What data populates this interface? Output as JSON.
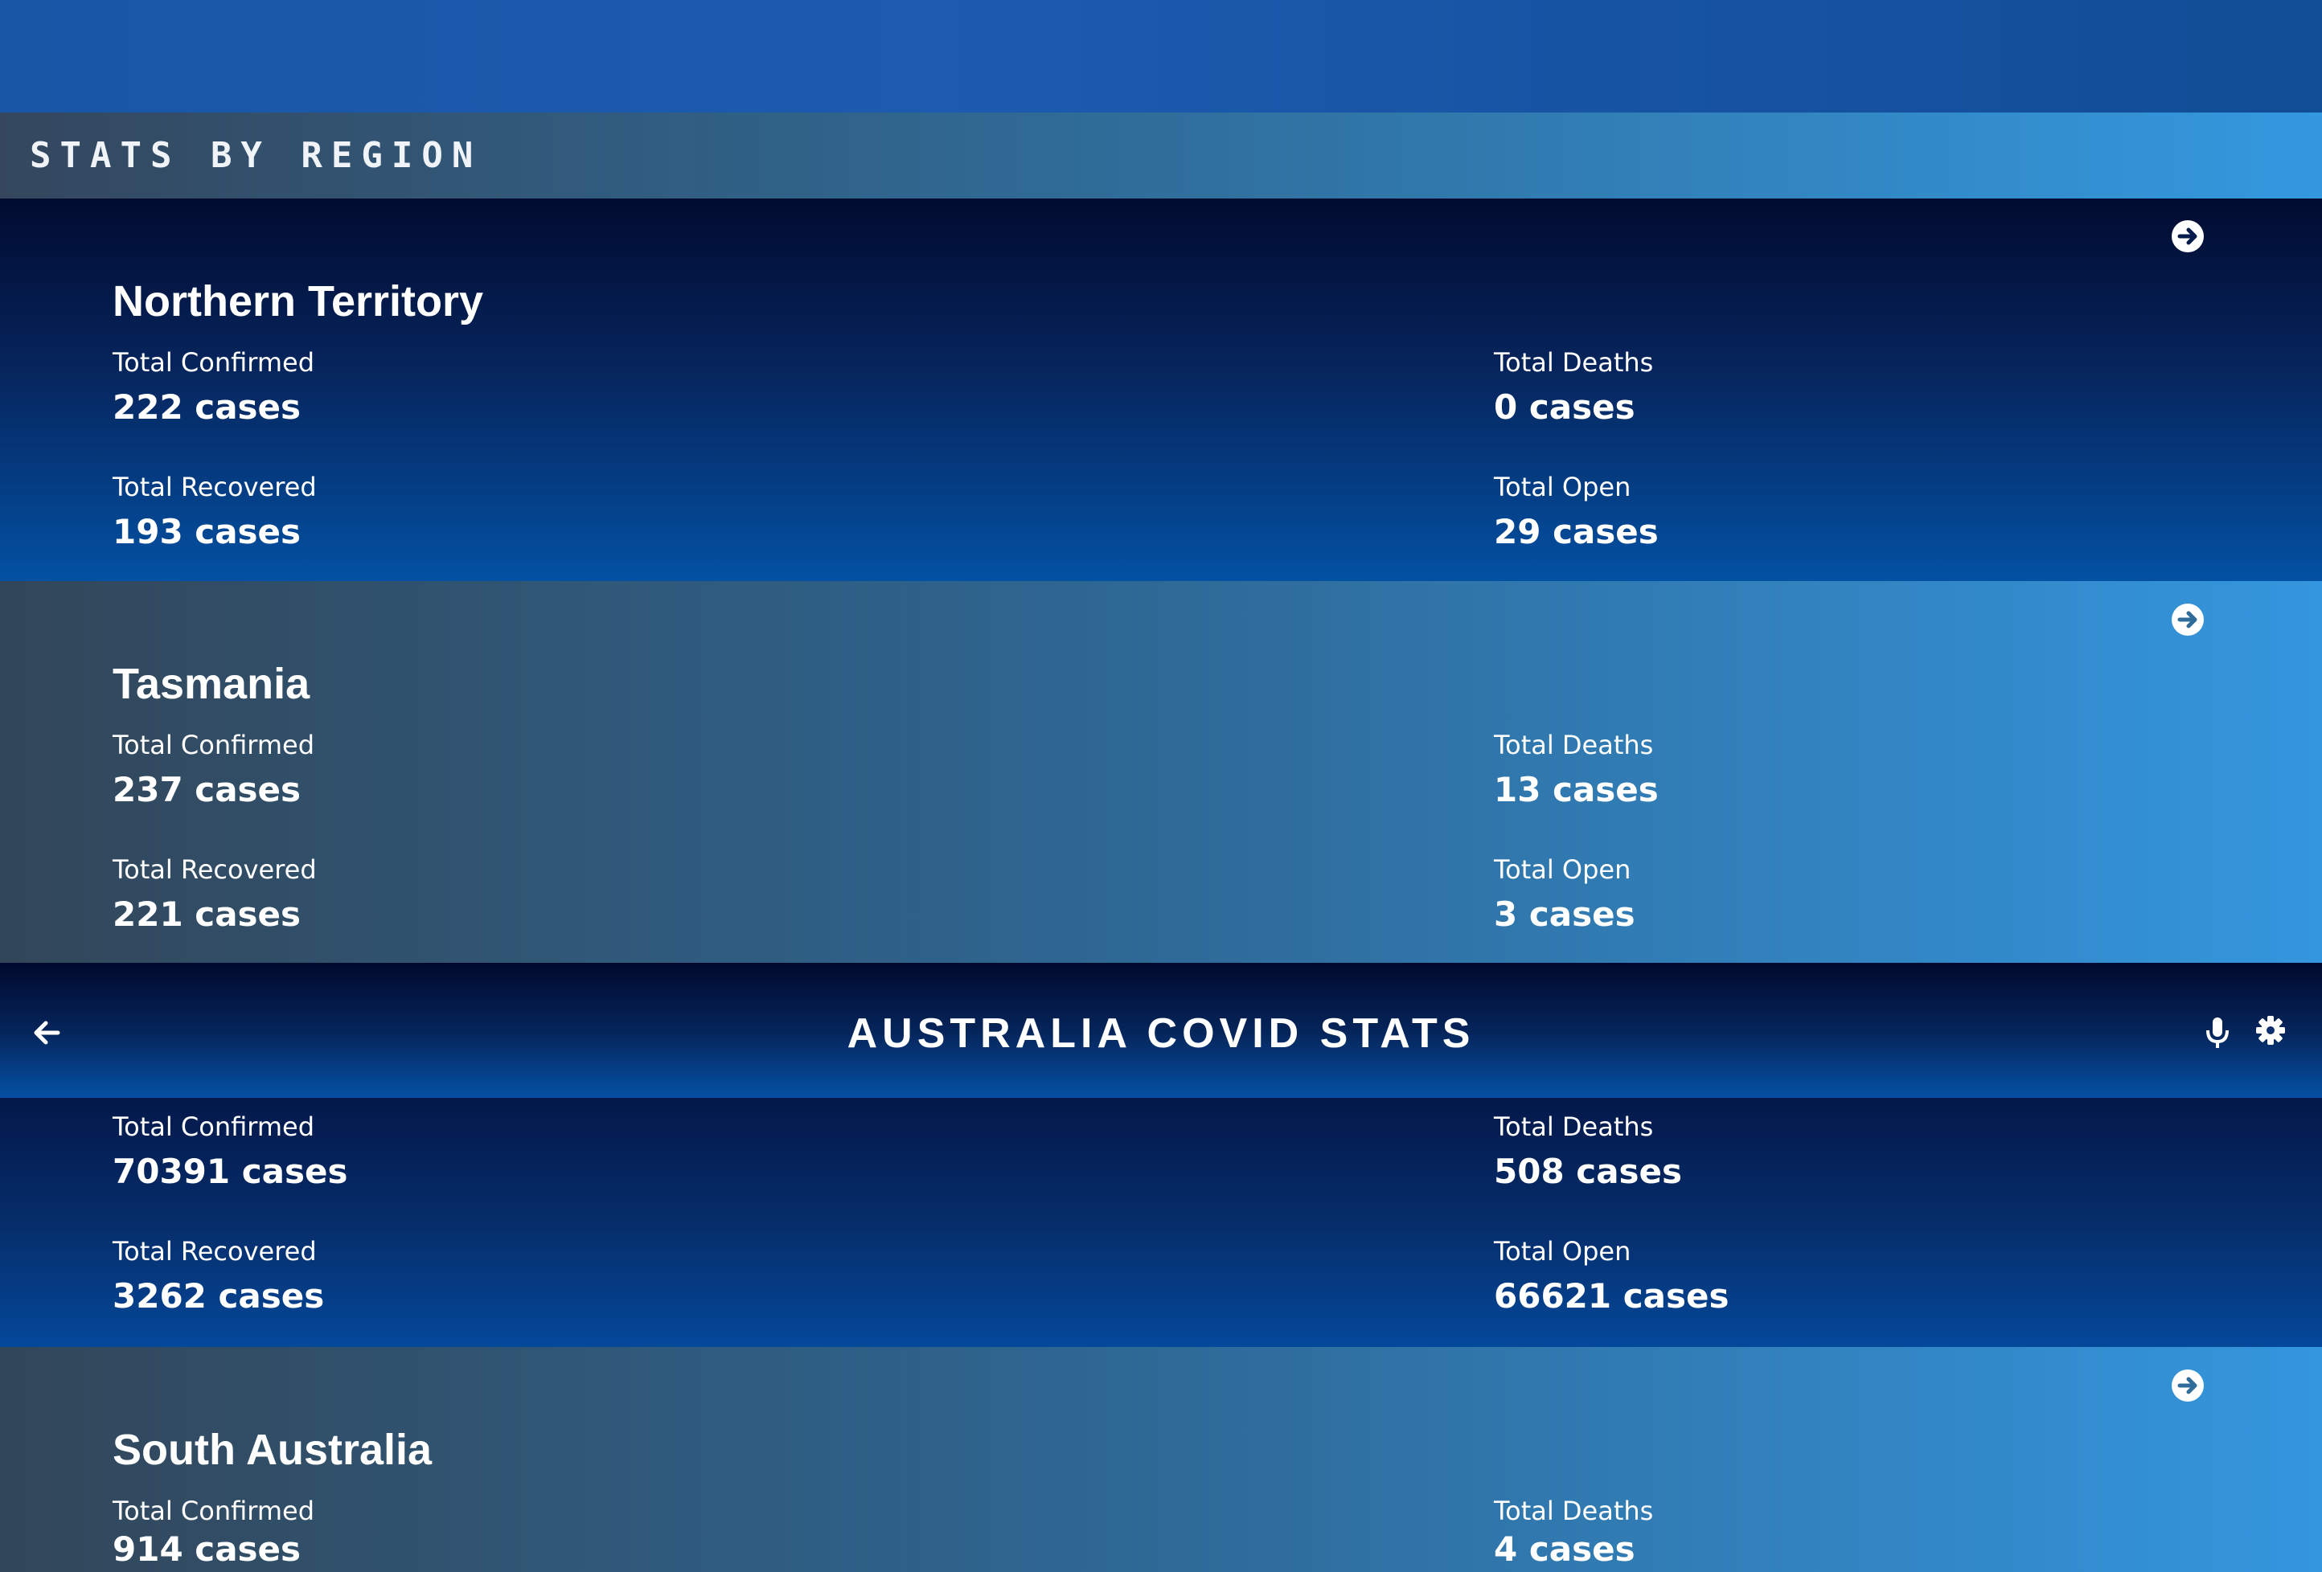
{
  "section": {
    "title": "STATS BY REGION"
  },
  "regions": [
    {
      "name": "Northern Territory",
      "confirmed_label": "Total Confirmed",
      "confirmed_value": "222 cases",
      "deaths_label": "Total Deaths",
      "deaths_value": "0 cases",
      "recovered_label": "Total Recovered",
      "recovered_value": "193 cases",
      "open_label": "Total Open",
      "open_value": "29 cases"
    },
    {
      "name": "Tasmania",
      "confirmed_label": "Total Confirmed",
      "confirmed_value": "237 cases",
      "deaths_label": "Total Deaths",
      "deaths_value": "13 cases",
      "recovered_label": "Total Recovered",
      "recovered_value": "221 cases",
      "open_label": "Total Open",
      "open_value": "3 cases"
    },
    {
      "name": "South Australia",
      "confirmed_label": "Total Confirmed",
      "confirmed_value": "914 cases",
      "deaths_label": "Total Deaths",
      "deaths_value": "4 cases"
    }
  ],
  "app_bar": {
    "title": "AUSTRALIA COVID STATS",
    "icons": {
      "back": "arrow-left-icon",
      "mic": "microphone-icon",
      "settings": "gear-icon",
      "detail": "arrow-circle-right-icon"
    }
  },
  "summary": {
    "confirmed_label": "Total Confirmed",
    "confirmed_value": "70391 cases",
    "deaths_label": "Total Deaths",
    "deaths_value": "508 cases",
    "recovered_label": "Total Recovered",
    "recovered_value": "3262 cases",
    "open_label": "Total Open",
    "open_value": "66621 cases"
  },
  "colors": {
    "dark_card_top": "#010b30",
    "dark_card_bottom": "#0351a3",
    "light_card_left": "#324659",
    "light_card_right": "#3496de",
    "text": "#ffffff"
  }
}
